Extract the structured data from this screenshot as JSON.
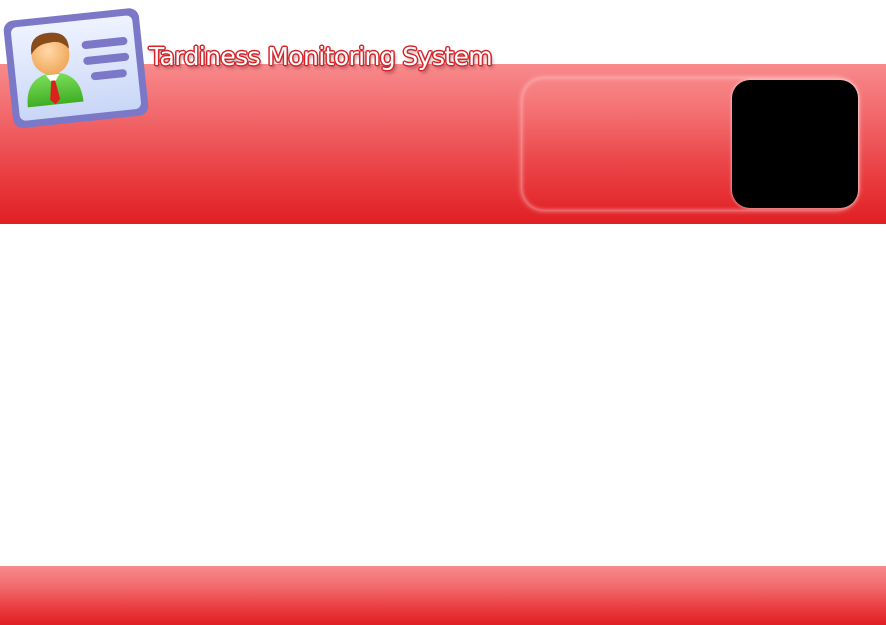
{
  "header": {
    "app_title": "Tardiness Monitoring System",
    "logo_icon": "user-id-card-icon"
  },
  "photo_panel": {
    "photo_icon": "profile-photo-placeholder"
  },
  "colors": {
    "accent_red": "#e01f24",
    "accent_red_light": "#f88a8c",
    "photo_background": "#000000",
    "card_frame": "#7b78c8",
    "card_face": "#d9e3fb",
    "avatar_shirt": "#58c93a",
    "avatar_tie": "#d9221c",
    "avatar_hair": "#8a4b1a"
  }
}
